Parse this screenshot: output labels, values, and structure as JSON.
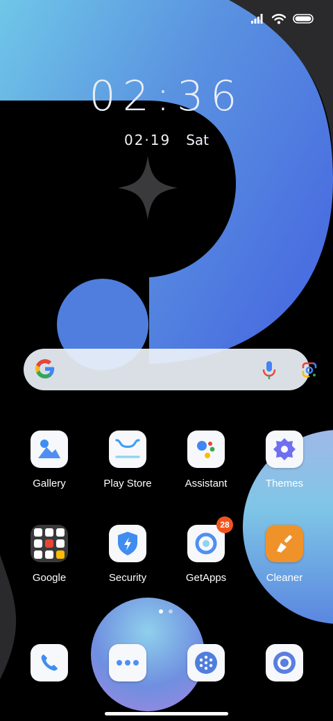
{
  "clock": {
    "hour": "02",
    "sep": ":",
    "minute": "36"
  },
  "date": {
    "month_day": "02·19",
    "weekday": "Sat"
  },
  "status_bar": {
    "signal_icon": "signal-icon",
    "wifi_icon": "wifi-icon",
    "battery_icon": "battery-icon"
  },
  "search_bar": {
    "logo": "google-g-icon",
    "mic_icon": "mic-icon",
    "lens_icon": "google-lens-icon"
  },
  "apps_row1": [
    {
      "label": "Gallery",
      "icon": "gallery-icon"
    },
    {
      "label": "Play Store",
      "icon": "play-store-icon"
    },
    {
      "label": "Assistant",
      "icon": "assistant-icon"
    },
    {
      "label": "Themes",
      "icon": "themes-icon"
    }
  ],
  "apps_row2": [
    {
      "label": "Google",
      "icon": "google-folder-icon"
    },
    {
      "label": "Security",
      "icon": "security-icon"
    },
    {
      "label": "GetApps",
      "icon": "getapps-icon",
      "badge": "28"
    },
    {
      "label": "Cleaner",
      "icon": "cleaner-icon"
    }
  ],
  "dock": [
    {
      "icon": "phone-icon"
    },
    {
      "icon": "messages-icon"
    },
    {
      "icon": "app-drawer-icon"
    },
    {
      "icon": "camera-icon"
    }
  ],
  "page_indicator": {
    "pages": 2,
    "current": 1
  },
  "colors": {
    "accent_blue": "#4a7de0",
    "light_cyan": "#7fd0e8",
    "badge_orange": "#f0541e"
  }
}
